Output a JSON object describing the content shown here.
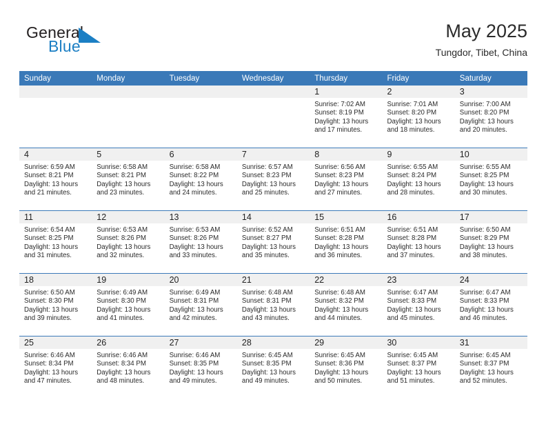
{
  "brand": {
    "name_part1": "General",
    "name_part2": "Blue",
    "flag_color": "#1c7fc4"
  },
  "header": {
    "title": "May 2025",
    "location": "Tungdor, Tibet, China"
  },
  "theme": {
    "header_blue": "#3a79b8",
    "daynum_band": "#f0f0f0",
    "text": "#2a2a2a"
  },
  "calendar": {
    "weekday_headers": [
      "Sunday",
      "Monday",
      "Tuesday",
      "Wednesday",
      "Thursday",
      "Friday",
      "Saturday"
    ],
    "weeks": [
      [
        {
          "day": "",
          "empty": true,
          "sunrise": "",
          "sunset": "",
          "daylight1": "",
          "daylight2": ""
        },
        {
          "day": "",
          "empty": true,
          "sunrise": "",
          "sunset": "",
          "daylight1": "",
          "daylight2": ""
        },
        {
          "day": "",
          "empty": true,
          "sunrise": "",
          "sunset": "",
          "daylight1": "",
          "daylight2": ""
        },
        {
          "day": "",
          "empty": true,
          "sunrise": "",
          "sunset": "",
          "daylight1": "",
          "daylight2": ""
        },
        {
          "day": "1",
          "empty": false,
          "sunrise": "Sunrise: 7:02 AM",
          "sunset": "Sunset: 8:19 PM",
          "daylight1": "Daylight: 13 hours",
          "daylight2": "and 17 minutes."
        },
        {
          "day": "2",
          "empty": false,
          "sunrise": "Sunrise: 7:01 AM",
          "sunset": "Sunset: 8:20 PM",
          "daylight1": "Daylight: 13 hours",
          "daylight2": "and 18 minutes."
        },
        {
          "day": "3",
          "empty": false,
          "sunrise": "Sunrise: 7:00 AM",
          "sunset": "Sunset: 8:20 PM",
          "daylight1": "Daylight: 13 hours",
          "daylight2": "and 20 minutes."
        }
      ],
      [
        {
          "day": "4",
          "empty": false,
          "sunrise": "Sunrise: 6:59 AM",
          "sunset": "Sunset: 8:21 PM",
          "daylight1": "Daylight: 13 hours",
          "daylight2": "and 21 minutes."
        },
        {
          "day": "5",
          "empty": false,
          "sunrise": "Sunrise: 6:58 AM",
          "sunset": "Sunset: 8:21 PM",
          "daylight1": "Daylight: 13 hours",
          "daylight2": "and 23 minutes."
        },
        {
          "day": "6",
          "empty": false,
          "sunrise": "Sunrise: 6:58 AM",
          "sunset": "Sunset: 8:22 PM",
          "daylight1": "Daylight: 13 hours",
          "daylight2": "and 24 minutes."
        },
        {
          "day": "7",
          "empty": false,
          "sunrise": "Sunrise: 6:57 AM",
          "sunset": "Sunset: 8:23 PM",
          "daylight1": "Daylight: 13 hours",
          "daylight2": "and 25 minutes."
        },
        {
          "day": "8",
          "empty": false,
          "sunrise": "Sunrise: 6:56 AM",
          "sunset": "Sunset: 8:23 PM",
          "daylight1": "Daylight: 13 hours",
          "daylight2": "and 27 minutes."
        },
        {
          "day": "9",
          "empty": false,
          "sunrise": "Sunrise: 6:55 AM",
          "sunset": "Sunset: 8:24 PM",
          "daylight1": "Daylight: 13 hours",
          "daylight2": "and 28 minutes."
        },
        {
          "day": "10",
          "empty": false,
          "sunrise": "Sunrise: 6:55 AM",
          "sunset": "Sunset: 8:25 PM",
          "daylight1": "Daylight: 13 hours",
          "daylight2": "and 30 minutes."
        }
      ],
      [
        {
          "day": "11",
          "empty": false,
          "sunrise": "Sunrise: 6:54 AM",
          "sunset": "Sunset: 8:25 PM",
          "daylight1": "Daylight: 13 hours",
          "daylight2": "and 31 minutes."
        },
        {
          "day": "12",
          "empty": false,
          "sunrise": "Sunrise: 6:53 AM",
          "sunset": "Sunset: 8:26 PM",
          "daylight1": "Daylight: 13 hours",
          "daylight2": "and 32 minutes."
        },
        {
          "day": "13",
          "empty": false,
          "sunrise": "Sunrise: 6:53 AM",
          "sunset": "Sunset: 8:26 PM",
          "daylight1": "Daylight: 13 hours",
          "daylight2": "and 33 minutes."
        },
        {
          "day": "14",
          "empty": false,
          "sunrise": "Sunrise: 6:52 AM",
          "sunset": "Sunset: 8:27 PM",
          "daylight1": "Daylight: 13 hours",
          "daylight2": "and 35 minutes."
        },
        {
          "day": "15",
          "empty": false,
          "sunrise": "Sunrise: 6:51 AM",
          "sunset": "Sunset: 8:28 PM",
          "daylight1": "Daylight: 13 hours",
          "daylight2": "and 36 minutes."
        },
        {
          "day": "16",
          "empty": false,
          "sunrise": "Sunrise: 6:51 AM",
          "sunset": "Sunset: 8:28 PM",
          "daylight1": "Daylight: 13 hours",
          "daylight2": "and 37 minutes."
        },
        {
          "day": "17",
          "empty": false,
          "sunrise": "Sunrise: 6:50 AM",
          "sunset": "Sunset: 8:29 PM",
          "daylight1": "Daylight: 13 hours",
          "daylight2": "and 38 minutes."
        }
      ],
      [
        {
          "day": "18",
          "empty": false,
          "sunrise": "Sunrise: 6:50 AM",
          "sunset": "Sunset: 8:30 PM",
          "daylight1": "Daylight: 13 hours",
          "daylight2": "and 39 minutes."
        },
        {
          "day": "19",
          "empty": false,
          "sunrise": "Sunrise: 6:49 AM",
          "sunset": "Sunset: 8:30 PM",
          "daylight1": "Daylight: 13 hours",
          "daylight2": "and 41 minutes."
        },
        {
          "day": "20",
          "empty": false,
          "sunrise": "Sunrise: 6:49 AM",
          "sunset": "Sunset: 8:31 PM",
          "daylight1": "Daylight: 13 hours",
          "daylight2": "and 42 minutes."
        },
        {
          "day": "21",
          "empty": false,
          "sunrise": "Sunrise: 6:48 AM",
          "sunset": "Sunset: 8:31 PM",
          "daylight1": "Daylight: 13 hours",
          "daylight2": "and 43 minutes."
        },
        {
          "day": "22",
          "empty": false,
          "sunrise": "Sunrise: 6:48 AM",
          "sunset": "Sunset: 8:32 PM",
          "daylight1": "Daylight: 13 hours",
          "daylight2": "and 44 minutes."
        },
        {
          "day": "23",
          "empty": false,
          "sunrise": "Sunrise: 6:47 AM",
          "sunset": "Sunset: 8:33 PM",
          "daylight1": "Daylight: 13 hours",
          "daylight2": "and 45 minutes."
        },
        {
          "day": "24",
          "empty": false,
          "sunrise": "Sunrise: 6:47 AM",
          "sunset": "Sunset: 8:33 PM",
          "daylight1": "Daylight: 13 hours",
          "daylight2": "and 46 minutes."
        }
      ],
      [
        {
          "day": "25",
          "empty": false,
          "sunrise": "Sunrise: 6:46 AM",
          "sunset": "Sunset: 8:34 PM",
          "daylight1": "Daylight: 13 hours",
          "daylight2": "and 47 minutes."
        },
        {
          "day": "26",
          "empty": false,
          "sunrise": "Sunrise: 6:46 AM",
          "sunset": "Sunset: 8:34 PM",
          "daylight1": "Daylight: 13 hours",
          "daylight2": "and 48 minutes."
        },
        {
          "day": "27",
          "empty": false,
          "sunrise": "Sunrise: 6:46 AM",
          "sunset": "Sunset: 8:35 PM",
          "daylight1": "Daylight: 13 hours",
          "daylight2": "and 49 minutes."
        },
        {
          "day": "28",
          "empty": false,
          "sunrise": "Sunrise: 6:45 AM",
          "sunset": "Sunset: 8:35 PM",
          "daylight1": "Daylight: 13 hours",
          "daylight2": "and 49 minutes."
        },
        {
          "day": "29",
          "empty": false,
          "sunrise": "Sunrise: 6:45 AM",
          "sunset": "Sunset: 8:36 PM",
          "daylight1": "Daylight: 13 hours",
          "daylight2": "and 50 minutes."
        },
        {
          "day": "30",
          "empty": false,
          "sunrise": "Sunrise: 6:45 AM",
          "sunset": "Sunset: 8:37 PM",
          "daylight1": "Daylight: 13 hours",
          "daylight2": "and 51 minutes."
        },
        {
          "day": "31",
          "empty": false,
          "sunrise": "Sunrise: 6:45 AM",
          "sunset": "Sunset: 8:37 PM",
          "daylight1": "Daylight: 13 hours",
          "daylight2": "and 52 minutes."
        }
      ]
    ]
  }
}
